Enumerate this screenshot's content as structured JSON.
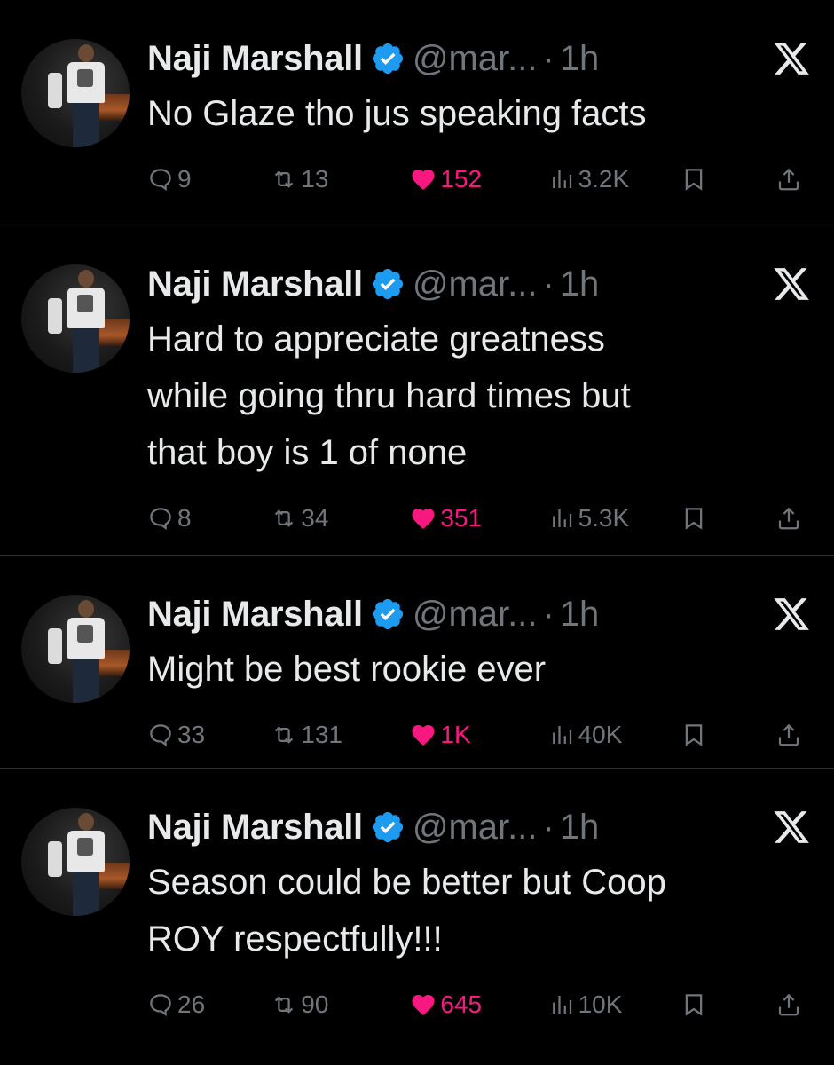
{
  "app": {
    "brand_icon": "x-logo-icon",
    "accent_like": "#f91880",
    "verified_color": "#1d9bf0",
    "muted_text": "#71767b"
  },
  "tweets": [
    {
      "name": "Naji Marshall",
      "handle": "@mar...",
      "dot": "·",
      "time": "1h",
      "text": "No Glaze tho jus speaking facts",
      "replies": "9",
      "reposts": "13",
      "likes": "152",
      "views": "3.2K"
    },
    {
      "name": "Naji Marshall",
      "handle": "@mar...",
      "dot": "·",
      "time": "1h",
      "text": "Hard to appreciate greatness\nwhile going thru hard times but\nthat boy is 1 of none",
      "replies": "8",
      "reposts": "34",
      "likes": "351",
      "views": "5.3K"
    },
    {
      "name": "Naji Marshall",
      "handle": "@mar...",
      "dot": "·",
      "time": "1h",
      "text": "Might be best rookie ever",
      "replies": "33",
      "reposts": "131",
      "likes": "1K",
      "views": "40K"
    },
    {
      "name": "Naji Marshall",
      "handle": "@mar...",
      "dot": "·",
      "time": "1h",
      "text": "Season could be better but Coop\nROY respectfully!!!",
      "replies": "26",
      "reposts": "90",
      "likes": "645",
      "views": "10K"
    }
  ]
}
